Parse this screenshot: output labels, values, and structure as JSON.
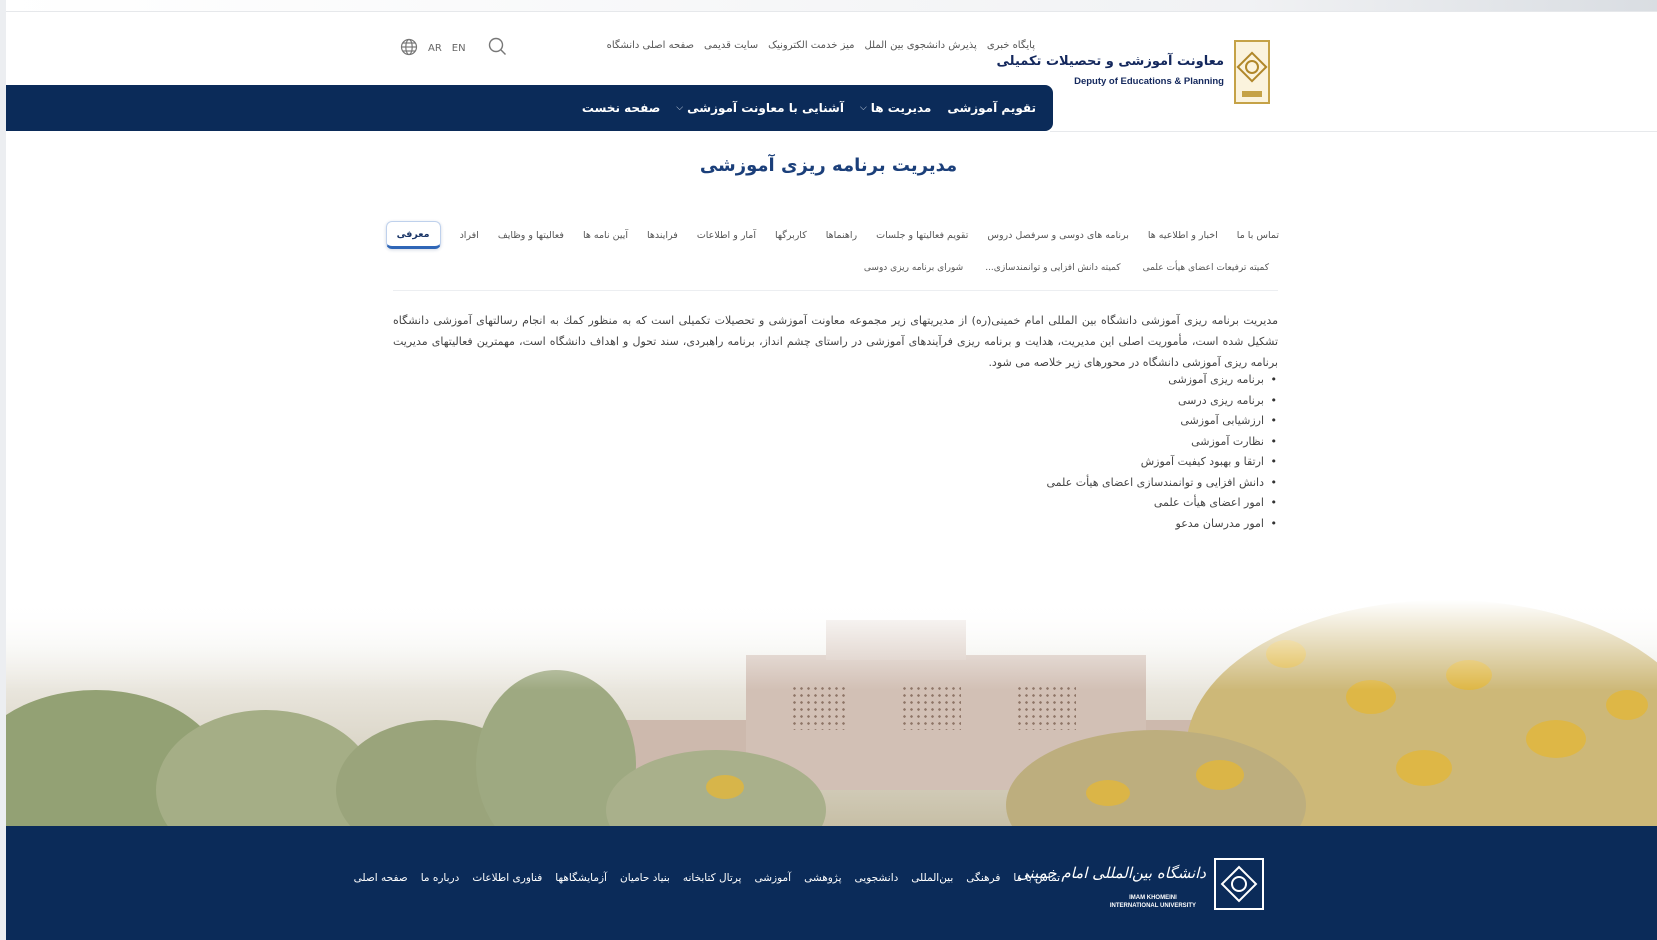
{
  "header": {
    "logo": {
      "title_fa": "معاونت آموزشی و تحصیلات تکمیلی",
      "title_en": "Deputy of Educations & Planning"
    },
    "top_links": [
      "صفحه اصلی دانشگاه",
      "سایت قدیمی",
      "میز خدمت الکترونیک",
      "پذیرش دانشجوی بین الملل",
      "پایگاه خبری"
    ],
    "languages": [
      "AR",
      "EN"
    ],
    "nav": [
      {
        "label": "صفحه نخست",
        "dropdown": false
      },
      {
        "label": "آشنایی با معاونت آموزشی",
        "dropdown": true
      },
      {
        "label": "مدیریت ها",
        "dropdown": true
      },
      {
        "label": "تقویم آموزشی",
        "dropdown": false
      }
    ],
    "chevron": "⌵"
  },
  "page": {
    "title": "مدیریت برنامه ریزی آموزشی"
  },
  "tabs": {
    "row1": [
      "معرفی",
      "افراد",
      "فعالیتها و وظایف",
      "آیین نامه ها",
      "فرایندها",
      "آمار و اطلاعات",
      "کاربرگها",
      "راهنماها",
      "تقویم فعالیتها و جلسات",
      "برنامه های دوسی و سرفصل دروس",
      "اخبار و اطلاعیه ها",
      "تماس با ما"
    ],
    "row2": [
      "شورای برنامه ریزی دوسی",
      "کمیته دانش افزایی و توانمندسازی...",
      "کمیته ترفیعات اعضای هیأت علمی"
    ],
    "active": "معرفی"
  },
  "content": {
    "intro": "مدیریت برنامه ریزی آموزشی دانشگاه بین المللی امام خمینی(ره) از مدیریتهای زیر مجموعه معاونت آموزشی و تحصیلات تکمیلی است که به منظور کمك به انجام رسالتهای آموزشی دانشگاه تشکیل شده است، مأموریت اصلی این مدیریت، هدایت و برنامه ریزی فرآیندهای آموزشی در راستای چشم انداز، برنامه راهبردی، سند تحول و اهداف دانشگاه است، مهمترین فعالیتهای مدیریت برنامه ریزی آموزشی دانشگاه در محورهای زیر خلاصه می شود.",
    "bullets": [
      "برنامه ریزی آموزشی",
      "برنامه ریزی درسی",
      "ارزشیابی آموزشی",
      "نظارت آموزشی",
      "ارتقا و بهبود کیفیت آموزش",
      "دانش افزایی و توانمندسازی اعضای هیأت علمی",
      "امور اعضای هیأت علمی",
      "امور مدرسان مدعو"
    ]
  },
  "footer": {
    "logo": {
      "title_fa": "دانشگاه بین‌المللی امام خمینی",
      "title_en_line1": "IMAM KHOMEINI",
      "title_en_line2": "INTERNATIONAL UNIVERSITY"
    },
    "links": [
      "صفحه اصلی",
      "درباره ما",
      "فناوری اطلاعات",
      "آزمایشگاهها",
      "بنیاد حامیان",
      "پرتال کتابخانه",
      "آموزشی",
      "پژوهشی",
      "دانشجویی",
      "بین‌المللی",
      "فرهنگی",
      "تماس با ما"
    ]
  },
  "colors": {
    "navy": "#0b2b59",
    "title_blue": "#1b3f7a",
    "tab_accent": "#2f66b7",
    "gold": "#c5a247"
  },
  "icons": [
    "globe-icon",
    "search-icon",
    "chevron-down-icon"
  ]
}
